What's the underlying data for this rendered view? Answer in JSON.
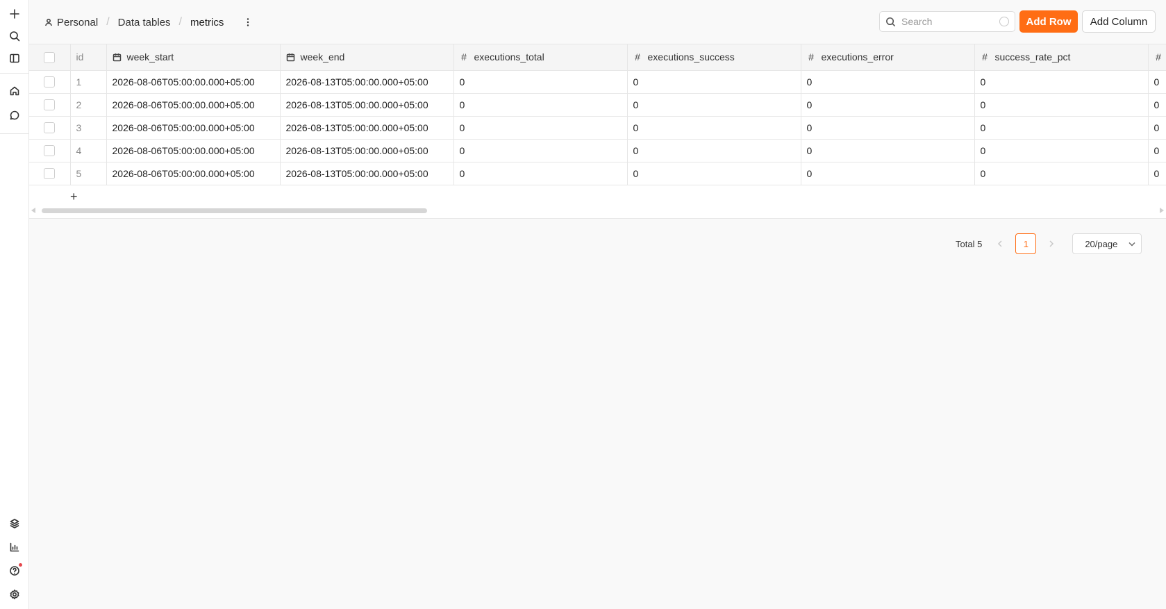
{
  "breadcrumb": {
    "items": [
      {
        "label": "Personal"
      },
      {
        "label": "Data tables"
      }
    ],
    "current": "metrics"
  },
  "search": {
    "placeholder": "Search",
    "value": ""
  },
  "toolbar": {
    "add_row_label": "Add Row",
    "add_column_label": "Add Column"
  },
  "table": {
    "columns": [
      {
        "label": "id",
        "type": "id"
      },
      {
        "label": "week_start",
        "type": "date"
      },
      {
        "label": "week_end",
        "type": "date"
      },
      {
        "label": "executions_total",
        "type": "number"
      },
      {
        "label": "executions_success",
        "type": "number"
      },
      {
        "label": "executions_error",
        "type": "number"
      },
      {
        "label": "success_rate_pct",
        "type": "number"
      },
      {
        "label": "",
        "type": "number"
      }
    ],
    "rows": [
      {
        "id": "1",
        "week_start": "2026-08-06T05:00:00.000+05:00",
        "week_end": "2026-08-13T05:00:00.000+05:00",
        "executions_total": "0",
        "executions_success": "0",
        "executions_error": "0",
        "success_rate_pct": "0",
        "extra": "0"
      },
      {
        "id": "2",
        "week_start": "2026-08-06T05:00:00.000+05:00",
        "week_end": "2026-08-13T05:00:00.000+05:00",
        "executions_total": "0",
        "executions_success": "0",
        "executions_error": "0",
        "success_rate_pct": "0",
        "extra": "0"
      },
      {
        "id": "3",
        "week_start": "2026-08-06T05:00:00.000+05:00",
        "week_end": "2026-08-13T05:00:00.000+05:00",
        "executions_total": "0",
        "executions_success": "0",
        "executions_error": "0",
        "success_rate_pct": "0",
        "extra": "0"
      },
      {
        "id": "4",
        "week_start": "2026-08-06T05:00:00.000+05:00",
        "week_end": "2026-08-13T05:00:00.000+05:00",
        "executions_total": "0",
        "executions_success": "0",
        "executions_error": "0",
        "success_rate_pct": "0",
        "extra": "0"
      },
      {
        "id": "5",
        "week_start": "2026-08-06T05:00:00.000+05:00",
        "week_end": "2026-08-13T05:00:00.000+05:00",
        "executions_total": "0",
        "executions_success": "0",
        "executions_error": "0",
        "success_rate_pct": "0",
        "extra": "0"
      }
    ],
    "add_row_glyph": "+"
  },
  "pagination": {
    "total_label": "Total 5",
    "current_page": "1",
    "page_size_label": "20/page"
  },
  "colors": {
    "accent": "#ff6d14",
    "notification": "#e5484d"
  },
  "icons": {
    "rail_top": [
      "plus-icon",
      "search-icon",
      "sidebar-toggle-icon",
      "home-icon",
      "chat-icon"
    ],
    "rail_bottom": [
      "templates-icon",
      "insights-icon",
      "help-icon",
      "settings-icon"
    ]
  }
}
